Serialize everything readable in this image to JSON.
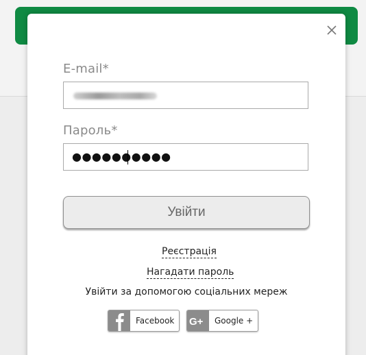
{
  "login_form": {
    "email_label": "E-mail*",
    "password_label": "Пароль*",
    "password_mask": "●●●●●●●●●●",
    "submit_label": "Увійти",
    "register_link": "Реєстрація",
    "remind_password_link": "Нагадати пароль",
    "social_caption": "Увійти за допомогою соціальних мереж"
  },
  "social_buttons": {
    "facebook": "Facebook",
    "google": "Google +"
  },
  "colors": {
    "header_green": "#0f8a43",
    "button_bg": "#ececec",
    "social_icon_bg": "#8c8c8c"
  },
  "icons": {
    "close": "close-icon",
    "facebook": "facebook-icon",
    "google": "google-plus-icon"
  }
}
